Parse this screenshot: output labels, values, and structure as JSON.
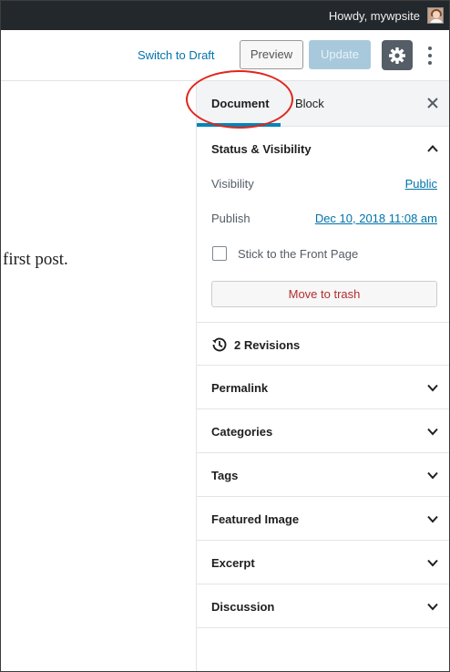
{
  "adminbar": {
    "greeting": "Howdy, mywpsite"
  },
  "header": {
    "switch_to_draft": "Switch to Draft",
    "preview": "Preview",
    "update": "Update"
  },
  "content": {
    "text": "first post."
  },
  "sidebar": {
    "tabs": {
      "document": "Document",
      "block": "Block"
    },
    "status": {
      "title": "Status & Visibility",
      "visibility_label": "Visibility",
      "visibility_value": "Public",
      "publish_label": "Publish",
      "publish_value": "Dec 10, 2018 11:08 am",
      "sticky_label": "Stick to the Front Page",
      "trash_label": "Move to trash"
    },
    "revisions": {
      "label": "2 Revisions"
    },
    "panels": [
      "Permalink",
      "Categories",
      "Tags",
      "Featured Image",
      "Excerpt",
      "Discussion"
    ]
  },
  "colors": {
    "adminbar_bg": "#23282d",
    "link": "#0073aa",
    "tab_accent": "#0085ba",
    "annotation": "#e0261c",
    "trash": "#b32d2e"
  }
}
